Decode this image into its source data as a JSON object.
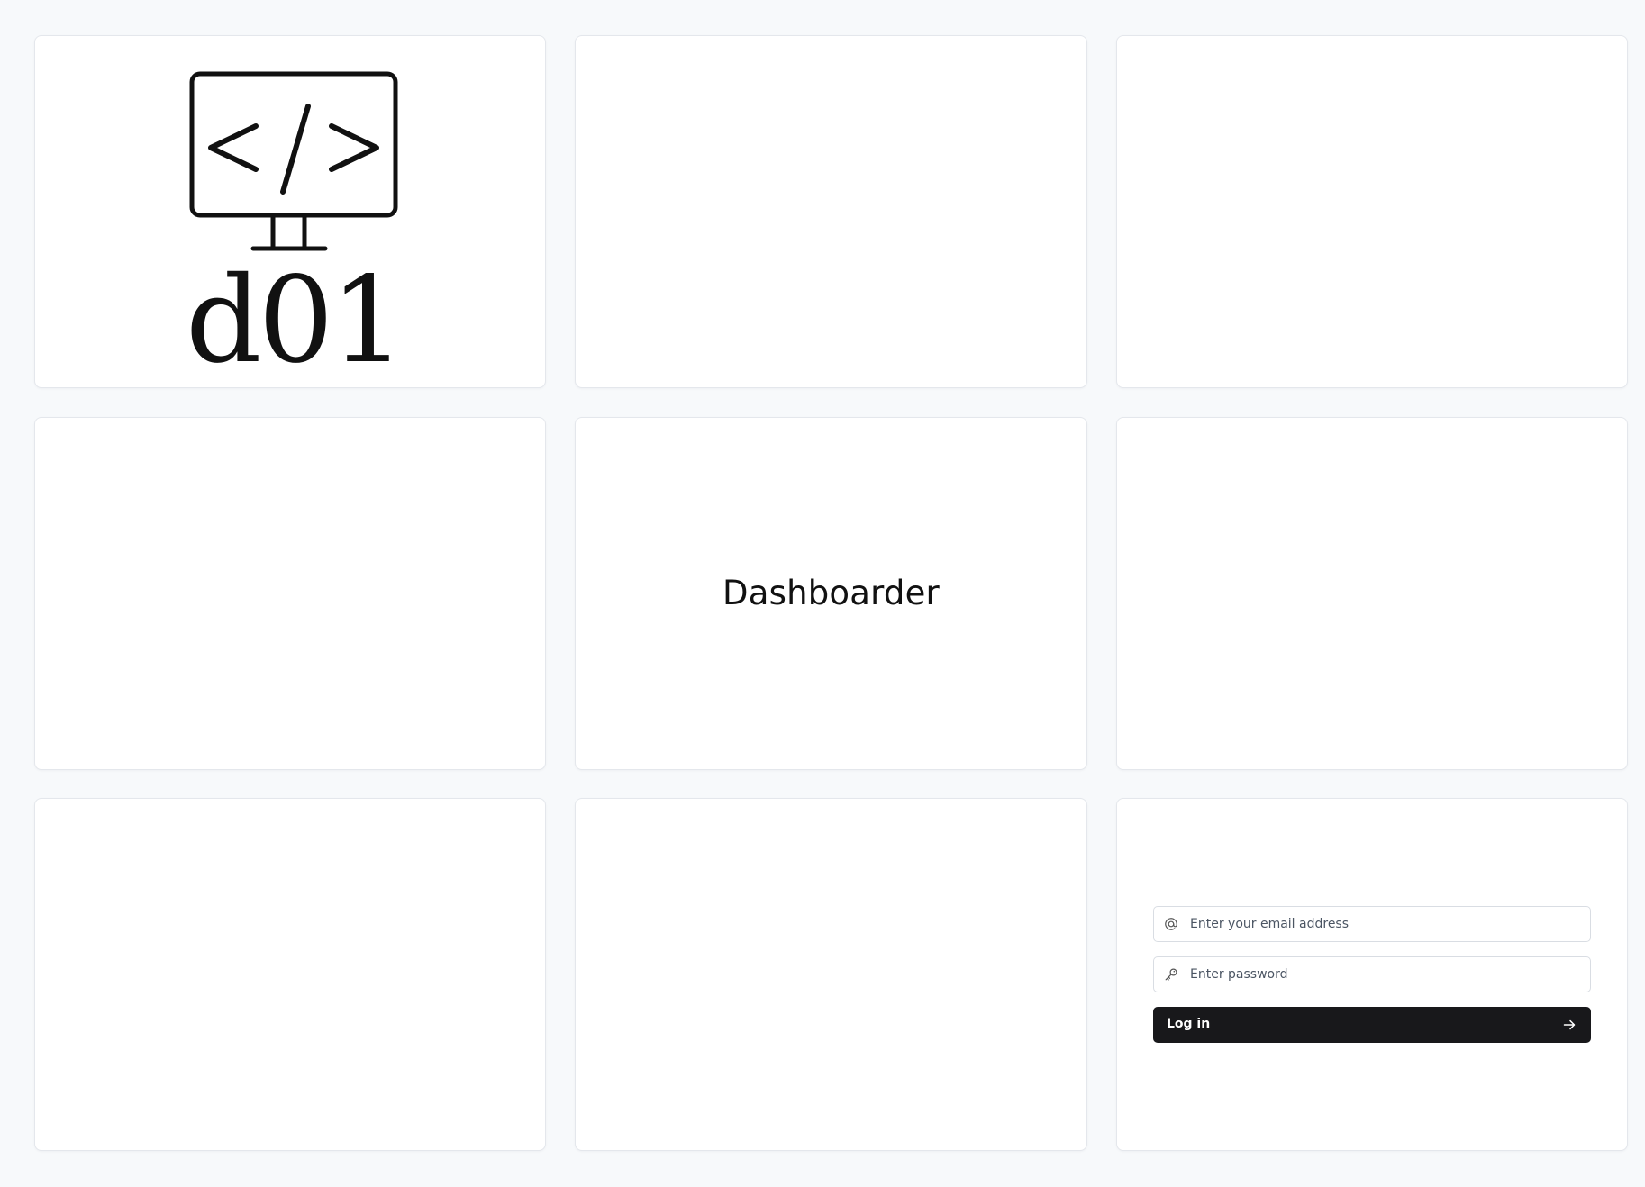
{
  "logo": {
    "text": "d01",
    "icon": "monitor-code-icon",
    "code_glyph": "</>"
  },
  "brand": {
    "title": "Dashboarder"
  },
  "login": {
    "email_placeholder": "Enter your email address",
    "email_value": "",
    "email_icon": "at-sign-icon",
    "password_placeholder": "Enter password",
    "password_value": "",
    "password_icon": "key-icon",
    "button_label": "Log in",
    "button_icon": "arrow-right-icon"
  },
  "colors": {
    "background": "#f7f9fb",
    "card": "#ffffff",
    "card_border": "#e4e7ec",
    "button_bg": "#18181b",
    "button_text": "#ffffff",
    "text_primary": "#111111",
    "placeholder": "#4b5563"
  }
}
